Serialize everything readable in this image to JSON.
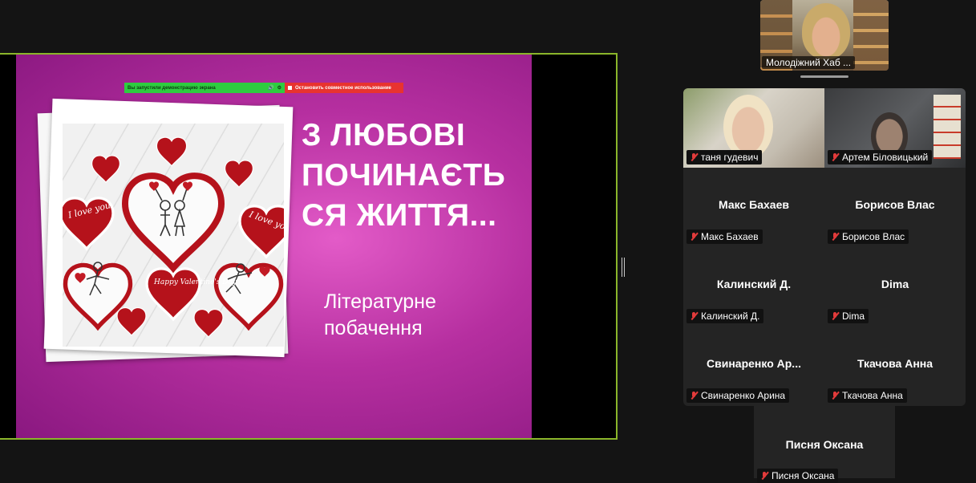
{
  "share_toolbar": {
    "status_text": "Вы запустили демонстрацию экрана",
    "stop_text": "Остановить совместное использование",
    "accent_green": "#2ecc40",
    "accent_red": "#e8332f"
  },
  "slide": {
    "title": "З ЛЮБОВІ\nПОЧИНАЄТЬ\nСЯ ЖИТТЯ...",
    "subtitle": "Літературне\nпобачення",
    "cookie_texts": [
      "I love you",
      "I love you",
      "Happy Valentine's Day"
    ]
  },
  "active_speaker": {
    "name": "Молодіжний Хаб ..."
  },
  "participants": [
    {
      "display": "",
      "label": "таня гудевич",
      "muted": true
    },
    {
      "display": "",
      "label": "Артем Біловицький",
      "muted": true
    },
    {
      "display": "Макс Бахаев",
      "label": "Макс Бахаев",
      "muted": true
    },
    {
      "display": "Борисов Влас",
      "label": "Борисов Влас",
      "muted": true
    },
    {
      "display": "Калинский Д.",
      "label": "Калинский Д.",
      "muted": true
    },
    {
      "display": "Dima",
      "label": "Dima",
      "muted": true
    },
    {
      "display": "Свинаренко  Ар...",
      "label": "Свинаренко Арина",
      "muted": true
    },
    {
      "display": "Ткачова Анна",
      "label": "Ткачова Анна",
      "muted": true
    },
    {
      "display": "Писня Оксана",
      "label": "Писня Оксана",
      "muted": true
    }
  ],
  "colors": {
    "share_border": "#8ab52a",
    "mute_icon": "#e23b3b",
    "slide_bg": "#b62fa0"
  }
}
